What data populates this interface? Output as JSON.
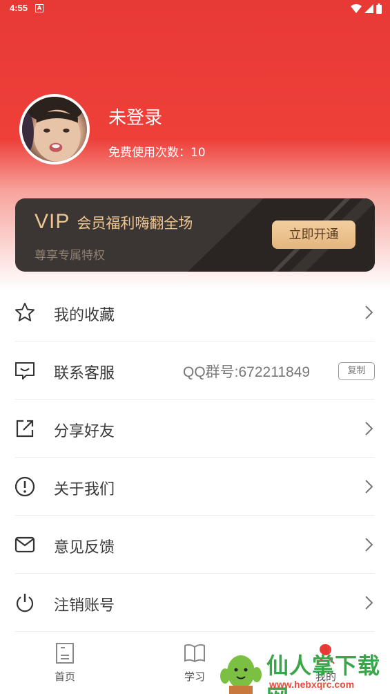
{
  "status_bar": {
    "time": "4:55",
    "notification_glyph": "A"
  },
  "profile": {
    "name": "未登录",
    "usage_text": "免费使用次数：10"
  },
  "vip": {
    "badge": "VIP",
    "slogan": "会员福利嗨翻全场",
    "subtitle": "尊享专属特权",
    "button": "立即开通"
  },
  "menu": [
    {
      "label": "我的收藏",
      "icon": "star-icon"
    },
    {
      "label": "联系客服",
      "icon": "chat-icon",
      "qq": "QQ群号:672211849",
      "copy": "复制"
    },
    {
      "label": "分享好友",
      "icon": "share-icon"
    },
    {
      "label": "关于我们",
      "icon": "info-icon"
    },
    {
      "label": "意见反馈",
      "icon": "mail-icon"
    },
    {
      "label": "注销账号",
      "icon": "power-icon"
    }
  ],
  "tabbar": [
    {
      "label": "首页",
      "icon": "home-doc-icon"
    },
    {
      "label": "学习",
      "icon": "book-icon"
    },
    {
      "label": "我的",
      "icon": "profile-icon"
    }
  ],
  "watermark": {
    "title": "仙人掌下载网",
    "url": "www.hebxqrc.com"
  },
  "colors": {
    "brand_red": "#e83a35",
    "vip_gold": "#ecc591",
    "vip_dark": "#3b3533",
    "watermark_green": "#3aa64a"
  }
}
